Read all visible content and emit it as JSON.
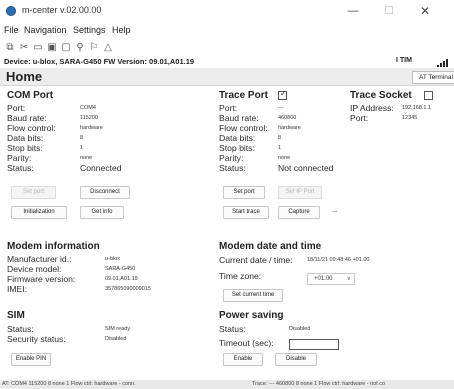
{
  "window": {
    "title": "m-center v.02.00.00",
    "minimize": "—",
    "maximize": "☐",
    "close": "✕"
  },
  "menu": [
    "File",
    "Navigation",
    "Settings",
    "Help"
  ],
  "toolbar_icons": [
    "copy-icon",
    "cut-icon",
    "folder-icon",
    "device-icon",
    "window-icon",
    "run-icon",
    "antenna-icon",
    "warning-icon"
  ],
  "device_bar": {
    "info": "Device: u-blox, SARA-G450   FW Version: 09.01,A01.19",
    "user": "I TIM"
  },
  "page": {
    "title": "Home",
    "tab": "AT Terminal"
  },
  "com_port": {
    "title": "COM Port",
    "labels": {
      "port": "Port:",
      "baud": "Baud rate:",
      "flow": "Flow control:",
      "data_bits": "Data bits:",
      "stop_bits": "Stop bits:",
      "parity": "Parity:",
      "status": "Status:"
    },
    "values": {
      "port": "COM4",
      "baud": "115200",
      "flow": "hardware",
      "data_bits": "8",
      "stop_bits": "1",
      "parity": "none",
      "status": "Connected"
    },
    "buttons": {
      "set_port": "Set port",
      "disconnect": "Disconnect",
      "initialization": "Initialization",
      "get_info": "Get info"
    }
  },
  "trace_port": {
    "title": "Trace Port",
    "checked": true,
    "labels": {
      "port": "Port:",
      "baud": "Baud rate:",
      "flow": "Flow control:",
      "data_bits": "Data bits:",
      "stop_bits": "Stop bits:",
      "parity": "Parity:",
      "status": "Status:"
    },
    "values": {
      "port": "---",
      "baud": "460800",
      "flow": "hardware",
      "data_bits": "8",
      "stop_bits": "1",
      "parity": "none",
      "status": "Not connected"
    },
    "buttons": {
      "set_port": "Set port",
      "set_ip_port": "Set IP Port",
      "start_trace": "Start trace",
      "capture": "Capture"
    },
    "extra": "---"
  },
  "trace_socket": {
    "title": "Trace Socket",
    "checked": false,
    "labels": {
      "ip": "IP Address:",
      "port": "Port:"
    },
    "values": {
      "ip": "192.168.1.1",
      "port": "12345"
    }
  },
  "modem_info": {
    "title": "Modem information",
    "labels": {
      "manufacturer": "Manufacturer id.:",
      "model": "Device model:",
      "firmware": "Firmware version:",
      "imei": "IMEI:"
    },
    "values": {
      "manufacturer": "u-blox",
      "model": "SARA-G450",
      "firmware": "09.01,A01.19",
      "imei": "357865090009015"
    }
  },
  "modem_date": {
    "title": "Modem date and time",
    "labels": {
      "current": "Current date / time:",
      "timezone": "Time zone:"
    },
    "values": {
      "current": "18/11/21 09:48:46 +01.00",
      "timezone": "+01.00"
    },
    "buttons": {
      "set_current": "Set current time"
    }
  },
  "sim": {
    "title": "SIM",
    "labels": {
      "status": "Status:",
      "security": "Security status:"
    },
    "values": {
      "status": "SIM ready",
      "security": "Disabled"
    },
    "buttons": {
      "enable_pin": "Enable PIN"
    }
  },
  "power_saving": {
    "title": "Power saving",
    "labels": {
      "status": "Status:",
      "timeout": "Timeout (sec):"
    },
    "values": {
      "status": "Disabled",
      "timeout": ""
    },
    "buttons": {
      "enable": "Enable",
      "disable": "Disable"
    }
  },
  "status_bar": {
    "left": "AT: COM4 115200 8 none 1 Flow ctrl: hardware - conn.",
    "right": "Trace: --- 460800 8 none 1 Flow ctrl: hardware - not co"
  }
}
